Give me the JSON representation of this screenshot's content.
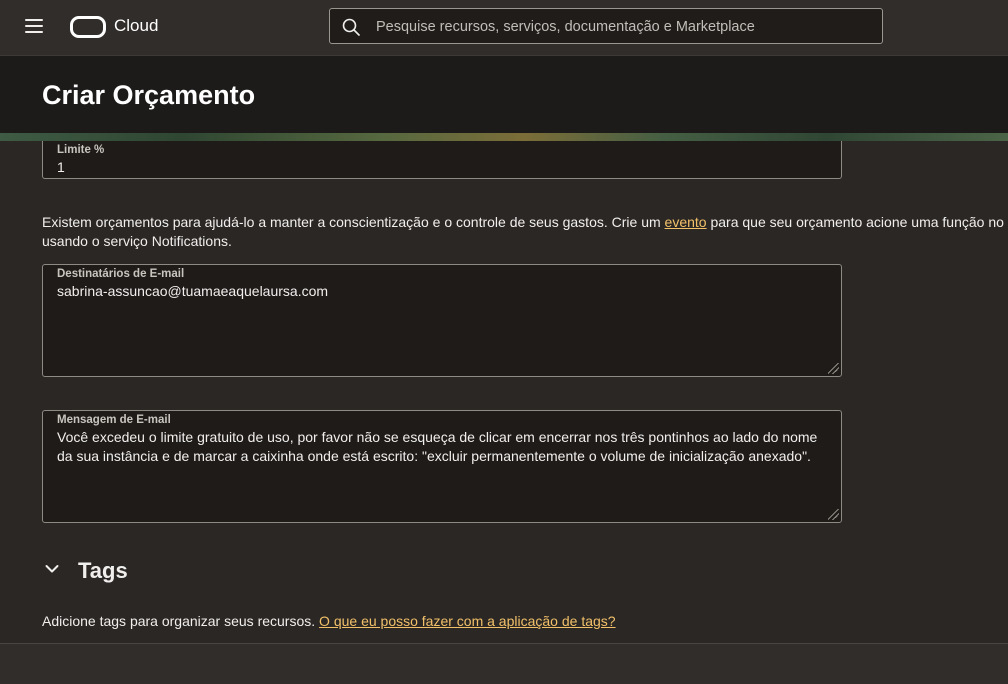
{
  "topbar": {
    "brand": "Cloud",
    "search_placeholder": "Pesquise recursos, serviços, documentação e Marketplace"
  },
  "header": {
    "title": "Criar Orçamento"
  },
  "form": {
    "limit": {
      "label": "Limite %",
      "value": "1"
    },
    "info": {
      "line1_before": "Existem orçamentos para ajudá-lo a manter a conscientização e o controle de seus gastos. Crie um ",
      "link": "evento",
      "line1_after": " para que seu orçamento acione uma função no",
      "line2": "usando o serviço Notifications."
    },
    "email_recipients": {
      "label": "Destinatários de E-mail",
      "value": "sabrina-assuncao@tuamaeaquelaursa.com"
    },
    "email_message": {
      "label": "Mensagem de E-mail",
      "line1": "Você excedeu o limite gratuito de uso, por favor não se esqueça de clicar em encerrar nos três pontinhos ao lado do nome",
      "line2": "da sua instância e de marcar a caixinha onde está escrito: \"excluir permanentemente o volume de inicialização anexado\"."
    }
  },
  "tags": {
    "title": "Tags",
    "description": "Adicione tags para organizar seus recursos. ",
    "link": "O que eu posso fazer com a aplicação de tags?"
  }
}
